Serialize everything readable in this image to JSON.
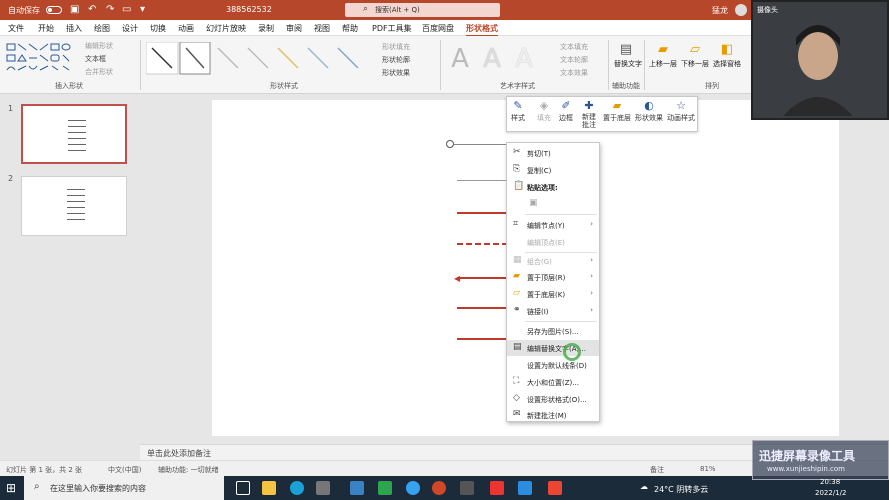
{
  "titlebar": {
    "autosave_label": "自动保存",
    "doc_name": "388562532",
    "search_placeholder": "搜索(Alt + Q)",
    "user_name": "猛龙"
  },
  "menu": [
    "文件",
    "开始",
    "插入",
    "绘图",
    "设计",
    "切换",
    "动画",
    "幻灯片放映",
    "录制",
    "审阅",
    "视图",
    "帮助",
    "PDF工具集",
    "百度网盘",
    "形状格式"
  ],
  "ribbon": {
    "insert_shape_items": [
      "编辑形状",
      "文本框",
      "合并形状"
    ],
    "insert_shape_label": "插入形状",
    "shape_style_label": "形状样式",
    "shape_fill": "形状填充",
    "shape_outline": "形状轮廓",
    "shape_effect": "形状效果",
    "wordart_label": "艺术字样式",
    "text_fill": "文本填充",
    "text_outline": "文本轮廓",
    "text_effect": "文本效果",
    "alt_text": "替换文字",
    "accessibility_label": "辅助功能",
    "arrange_label": "排列",
    "bring_forward": "上移一层",
    "send_backward": "下移一层",
    "selection_pane": "选择窗格"
  },
  "slides": [
    {
      "num": "1"
    },
    {
      "num": "2"
    }
  ],
  "mini_toolbar": [
    "样式",
    "填充",
    "边框",
    "新建批注",
    "置于底层",
    "形状效果",
    "动画样式"
  ],
  "context_menu": [
    {
      "label": "剪切(T)",
      "icon": "scissors-icon",
      "arrow": ""
    },
    {
      "label": "复制(C)",
      "icon": "copy-icon",
      "arrow": ""
    },
    {
      "label": "粘贴选项:",
      "icon": "paste-icon",
      "arrow": ""
    },
    {
      "label": "",
      "icon": "paste-option-icon",
      "arrow": ""
    },
    {
      "label": "编辑节点(Y)",
      "icon": "edit-points-icon",
      "arrow": "›"
    },
    {
      "label": "编辑顶点(E)",
      "icon": "",
      "arrow": ""
    },
    {
      "label": "组合(G)",
      "icon": "group-icon",
      "arrow": "›"
    },
    {
      "label": "置于顶层(R)",
      "icon": "bring-front-icon",
      "arrow": "›"
    },
    {
      "label": "置于底层(K)",
      "icon": "send-back-icon",
      "arrow": "›"
    },
    {
      "label": "链接(I)",
      "icon": "link-icon",
      "arrow": "›"
    },
    {
      "label": "另存为图片(S)...",
      "icon": "",
      "arrow": ""
    },
    {
      "label": "编辑替换文字(A)...",
      "icon": "alt-text-icon",
      "arrow": ""
    },
    {
      "label": "设置为默认线条(D)",
      "icon": "",
      "arrow": ""
    },
    {
      "label": "大小和位置(Z)...",
      "icon": "size-icon",
      "arrow": ""
    },
    {
      "label": "设置形状格式(O)...",
      "icon": "format-shape-icon",
      "arrow": ""
    },
    {
      "label": "新建批注(M)",
      "icon": "comment-icon",
      "arrow": ""
    }
  ],
  "notes_placeholder": "单击此处添加备注",
  "status": {
    "slide_info": "幻灯片 第 1 张，共 2 张",
    "language": "中文(中国)",
    "accessibility": "辅助功能: 一切就绪",
    "notes_btn": "备注",
    "zoom": "81%"
  },
  "taskbar": {
    "search_placeholder": "在这里输入你要搜索的内容",
    "weather": "24°C 阴转多云",
    "time": "20:38",
    "date": "2022/1/2"
  },
  "webcam": {
    "label": "摄像头"
  },
  "watermark": {
    "title": "迅捷屏幕录像工具",
    "url": "www.xunjieshipin.com"
  }
}
